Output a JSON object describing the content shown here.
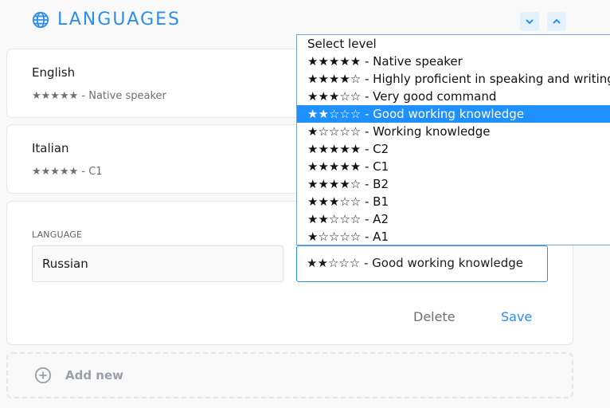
{
  "header": {
    "title": "LANGUAGES",
    "icon": "globe-icon",
    "collapse_icon": "chevron-down-icon",
    "expand_icon": "chevron-up-icon"
  },
  "languages": [
    {
      "name": "English",
      "level": "★★★★★ - Native speaker"
    },
    {
      "name": "Italian",
      "level": "★★★★★ - C1"
    }
  ],
  "edit_form": {
    "language_label": "LANGUAGE",
    "language_value": "Russian",
    "level_value": "★★☆☆☆ - Good working knowledge",
    "delete_label": "Delete",
    "save_label": "Save"
  },
  "level_dropdown": {
    "options": [
      "Select level",
      "★★★★★ - Native speaker",
      "★★★★☆ - Highly proficient in speaking and writing",
      "★★★☆☆ - Very good command",
      "★★☆☆☆ - Good working knowledge",
      "★☆☆☆☆ - Working knowledge",
      "★★★★★ - C2",
      "★★★★★ - C1",
      "★★★★☆ - B2",
      "★★★☆☆ - B1",
      "★★☆☆☆ - A2",
      "★☆☆☆☆ - A1"
    ],
    "selected_index": 4
  },
  "add_new": {
    "label": "Add new",
    "icon": "plus-circle-icon"
  },
  "colors": {
    "accent": "#2a8ff0",
    "selected_option": "#1e90ff",
    "muted_text": "#6f6f6f",
    "delete_text": "#6f6f6f",
    "add_new_text": "#9aa0a8"
  }
}
